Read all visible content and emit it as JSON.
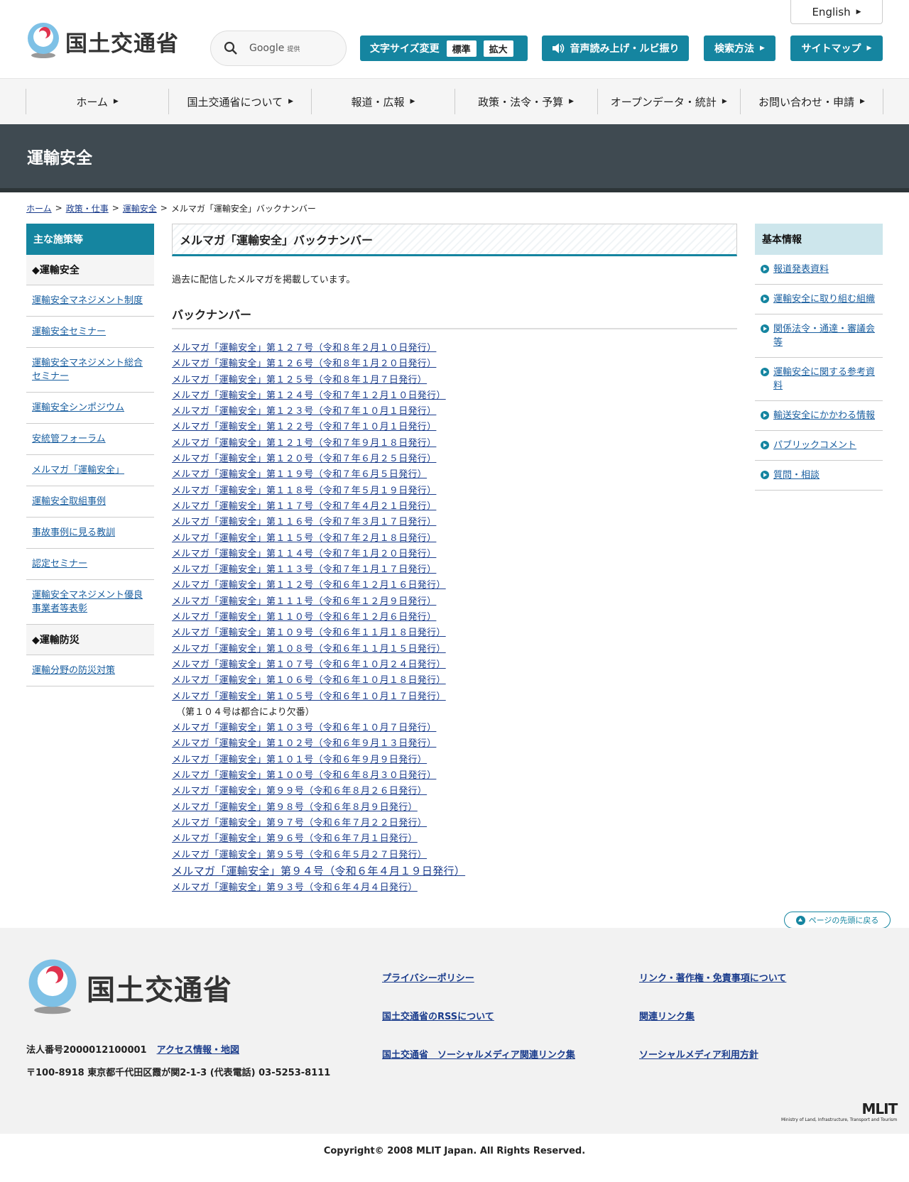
{
  "header": {
    "logo_text": "国土交通省",
    "english_label": "English",
    "search": {
      "brand": "Google",
      "suffix": "提供"
    },
    "font_size": {
      "label": "文字サイズ変更",
      "standard": "標準",
      "large": "拡大"
    },
    "audio_label": "音声読み上げ・ルビ振り",
    "howto_label": "検索方法",
    "sitemap_label": "サイトマップ"
  },
  "gnav": [
    {
      "label": "ホーム"
    },
    {
      "label": "国土交通省について"
    },
    {
      "label": "報道・広報"
    },
    {
      "label": "政策・法令・予算"
    },
    {
      "label": "オープンデータ・統計"
    },
    {
      "label": "お問い合わせ・申請"
    }
  ],
  "banner": {
    "title": "運輸安全"
  },
  "breadcrumb": {
    "items": [
      "ホーム",
      "政策・仕事",
      "運輸安全"
    ],
    "sep": ">",
    "current": "メルマガ「運輸安全」バックナンバー"
  },
  "left_nav": {
    "heading": "主な施策等",
    "section1": "◆運輸安全",
    "items1": [
      "運輸安全マネジメント制度",
      "運輸安全セミナー",
      "運輸安全マネジメント総合セミナー",
      "運輸安全シンポジウム",
      "安統管フォーラム",
      "メルマガ「運輸安全」",
      "運輸安全取組事例",
      "事故事例に見る教訓",
      "認定セミナー",
      "運輸安全マネジメント優良事業者等表彰"
    ],
    "section2": "◆運輸防災",
    "items2": [
      "運輸分野の防災対策"
    ]
  },
  "main": {
    "title": "メルマガ「運輸安全」バックナンバー",
    "intro": "過去に配信したメルマガを掲載しています。",
    "subtitle": "バックナンバー",
    "issues": [
      "メルマガ「運輸安全」第１２７号（令和８年２月１０日発行）",
      "メルマガ「運輸安全」第１２６号（令和８年１月２０日発行）",
      "メルマガ「運輸安全」第１２５号（令和８年１月７日発行）",
      "メルマガ「運輸安全」第１２４号（令和７年１２月１０日発行）",
      "メルマガ「運輸安全」第１２３号（令和７年１０月１日発行）",
      "メルマガ「運輸安全」第１２２号（令和７年１０月１日発行）",
      "メルマガ「運輸安全」第１２１号（令和７年９月１８日発行）",
      "メルマガ「運輸安全」第１２０号（令和７年６月２５日発行）",
      "メルマガ「運輸安全」第１１９号（令和７年６月５日発行）",
      "メルマガ「運輸安全」第１１８号（令和７年５月１９日発行）",
      "メルマガ「運輸安全」第１１７号（令和７年４月２１日発行）",
      "メルマガ「運輸安全」第１１６号（令和７年３月１７日発行）",
      "メルマガ「運輸安全」第１１５号（令和７年２月１８日発行）",
      "メルマガ「運輸安全」第１１４号（令和７年１月２０日発行）",
      "メルマガ「運輸安全」第１１３号（令和７年１月１７日発行）",
      "メルマガ「運輸安全」第１１２号（令和６年１２月１６日発行）",
      "メルマガ「運輸安全」第１１１号（令和６年１２月９日発行）",
      "メルマガ「運輸安全」第１１０号（令和６年１２月６日発行）",
      "メルマガ「運輸安全」第１０９号（令和６年１１月１８日発行）",
      "メルマガ「運輸安全」第１０８号（令和６年１１月１５日発行）",
      "メルマガ「運輸安全」第１０７号（令和６年１０月２４日発行）",
      "メルマガ「運輸安全」第１０６号（令和６年１０月１８日発行）",
      "メルマガ「運輸安全」第１０５号（令和６年１０月１７日発行）"
    ],
    "note": "（第１０４号は都合により欠番）",
    "issues2": [
      "メルマガ「運輸安全」第１０３号（令和６年１０月７日発行）",
      "メルマガ「運輸安全」第１０２号（令和６年９月１３日発行）",
      "メルマガ「運輸安全」第１０１号（令和６年９月９日発行）",
      "メルマガ「運輸安全」第１００号（令和６年８月３０日発行）",
      "メルマガ「運輸安全」第９９号（令和６年８月２６日発行）",
      "メルマガ「運輸安全」第９８号（令和６年８月９日発行）",
      "メルマガ「運輸安全」第９７号（令和６年７月２２日発行）",
      "メルマガ「運輸安全」第９６号（令和６年７月１日発行）",
      "メルマガ「運輸安全」第９５号（令和６年５月２７日発行）"
    ],
    "issue_big": "メルマガ「運輸安全」第９４号（令和６年４月１９日発行）",
    "issue_last": "メルマガ「運輸安全」第９３号（令和６年４月４日発行）"
  },
  "right_nav": {
    "heading": "基本情報",
    "items": [
      "報道発表資料",
      "運輸安全に取り組む組織",
      "関係法令・通達・審議会等",
      "運輸安全に関する参考資料",
      "輸送安全にかかわる情報",
      "パブリックコメント",
      "質問・相談"
    ]
  },
  "pagetop_label": "ページの先頭に戻る",
  "footer": {
    "logo_text": "国土交通省",
    "corp_no": "法人番号2000012100001",
    "access": "アクセス情報・地図",
    "address": "〒100-8918 東京都千代田区霞が関2-1-3 (代表電話) 03-5253-8111",
    "links_col1": [
      "プライバシーポリシー",
      "国土交通省のRSSについて",
      "国土交通省　ソーシャルメディア関連リンク集"
    ],
    "links_col2": [
      "リンク・著作権・免責事項について",
      "関連リンク集",
      "ソーシャルメディア利用方針"
    ],
    "mlit_mark": "MLIT",
    "mlit_sub": "Ministry of Land, Infrastructure, Transport and Tourism",
    "copyright": "Copyright© 2008 MLIT Japan. All Rights Reserved."
  },
  "colors": {
    "accent": "#1585a0",
    "banner": "#3f4a51",
    "link": "#1a3c8c"
  }
}
